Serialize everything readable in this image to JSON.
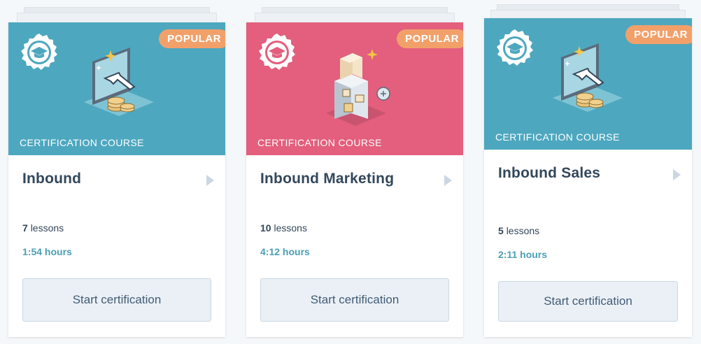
{
  "cards": [
    {
      "badge": "POPULAR",
      "category": "CERTIFICATION COURSE",
      "title": "Inbound",
      "lessons_count": "7",
      "lessons_label": "lessons",
      "duration": "1:54 hours",
      "button_label": "Start certification",
      "banner_color": "#4da7bf",
      "illustration": "computer-cursor-coins-icon"
    },
    {
      "badge": "POPULAR",
      "category": "CERTIFICATION COURSE",
      "title": "Inbound Marketing",
      "lessons_count": "10",
      "lessons_label": "lessons",
      "duration": "4:12 hours",
      "button_label": "Start certification",
      "banner_color": "#e35f7d",
      "illustration": "building-blocks-icon"
    },
    {
      "badge": "POPULAR",
      "category": "CERTIFICATION COURSE",
      "title": "Inbound Sales",
      "lessons_count": "5",
      "lessons_label": "lessons",
      "duration": "2:11 hours",
      "button_label": "Start certification",
      "banner_color": "#4da7bf",
      "illustration": "computer-cursor-coins-icon"
    }
  ],
  "colors": {
    "teal": "#4da7bf",
    "pink": "#e35f7d",
    "badge": "#f2a06a",
    "link": "#4a9fb3"
  }
}
